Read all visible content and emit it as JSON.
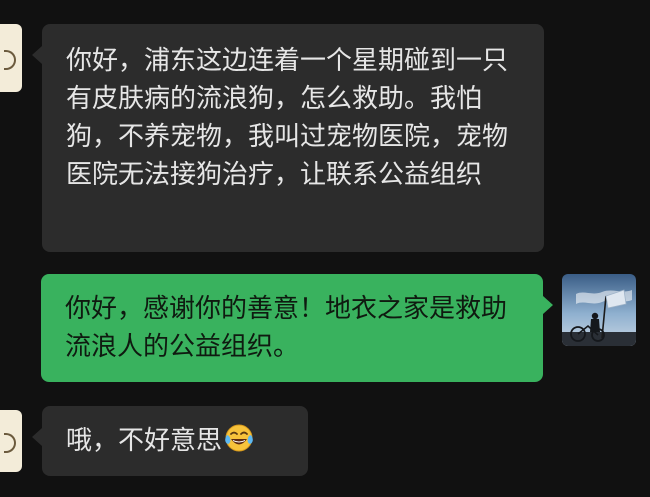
{
  "messages": [
    {
      "side": "left",
      "text": "你好，浦东这边连着一个星期碰到一只有皮肤病的流浪狗，怎么救助。我怕狗，不养宠物，我叫过宠物医院，宠物医院无法接狗治疗，让联系公益组织"
    },
    {
      "side": "right",
      "text": "你好，感谢你的善意！地衣之家是救助流浪人的公益组织。"
    },
    {
      "side": "left",
      "text": "哦，不好意思",
      "emoji": "tears-of-joy-emoji"
    }
  ],
  "colors": {
    "background": "#111111",
    "incoming_bubble": "#2c2c2c",
    "outgoing_bubble": "#39b25e"
  }
}
